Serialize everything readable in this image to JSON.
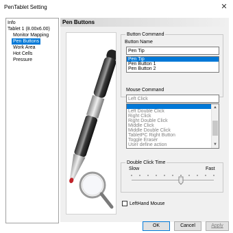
{
  "window": {
    "title": "PenTablet Setting"
  },
  "sidebar": {
    "items": [
      {
        "label": "Info",
        "level": 0,
        "selected": false
      },
      {
        "label": "Tablet  1 (8.00x6.00)",
        "level": 0,
        "selected": false
      },
      {
        "label": "Monitor Mapping",
        "level": 1,
        "selected": false
      },
      {
        "label": "Pen Buttons",
        "level": 1,
        "selected": true
      },
      {
        "label": "Work Area",
        "level": 1,
        "selected": false
      },
      {
        "label": "Hot Cells",
        "level": 1,
        "selected": false
      },
      {
        "label": "Pressure",
        "level": 1,
        "selected": false
      }
    ]
  },
  "main": {
    "header": "Pen Buttons",
    "button_command": {
      "group_label": "Button Command",
      "name_label": "Button Name",
      "name_value": "Pen Tip",
      "buttons": [
        "Pen Tip",
        "Pen Button 1",
        "Pen Button 2"
      ],
      "selected_button": 0
    },
    "mouse_command": {
      "label": "Mouse Command",
      "value": "Left Click",
      "options": [
        "",
        "Left Double Click",
        "Right Click",
        "Right Double Click",
        "Middle Click",
        "Middle Double Click",
        "TabletPC Right Button",
        "Toggle Eraser",
        "User define action"
      ],
      "selected_option": 0
    },
    "double_click": {
      "group_label": "Double Click Time",
      "slow_label": "Slow",
      "fast_label": "Fast",
      "level": 0.6
    },
    "lefthand": {
      "label": "LeftHand Mouse",
      "checked": false
    }
  },
  "footer": {
    "ok": "OK",
    "cancel": "Cancel",
    "apply": "Apply"
  },
  "colors": {
    "selection": "#0078d7",
    "panel": "#f0f0f0",
    "pen_tip": "#c0242a"
  }
}
